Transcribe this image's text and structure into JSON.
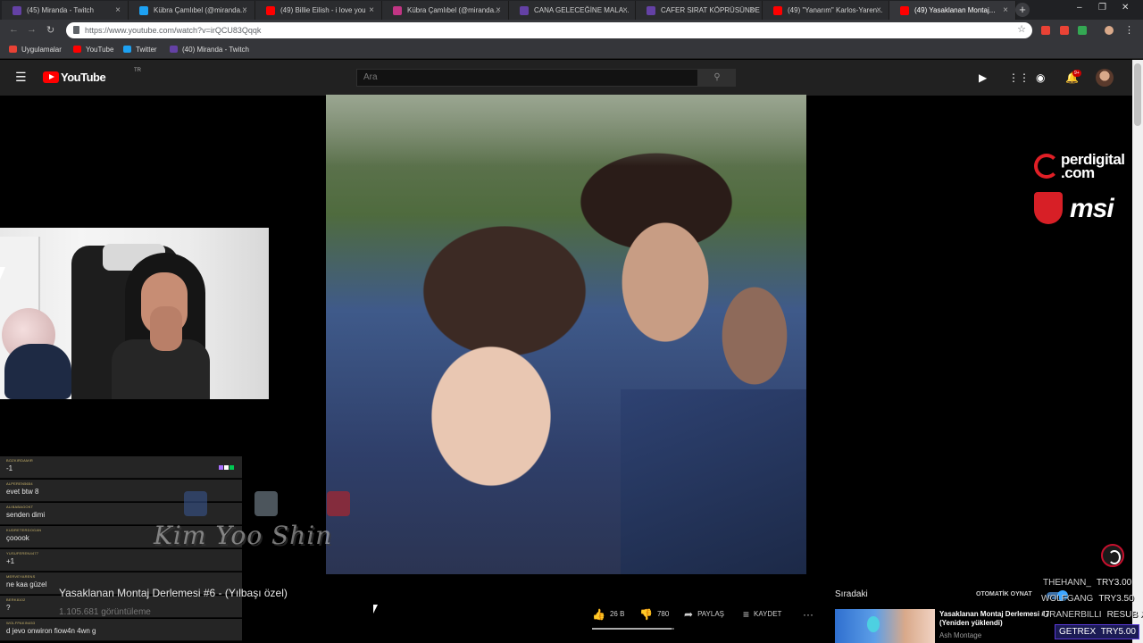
{
  "browser": {
    "tabs": [
      {
        "title": "(45) Miranda - Twitch",
        "color": "#6441a5"
      },
      {
        "title": "Kübra Çamlıbel (@miranda...",
        "color": "#1da1f2"
      },
      {
        "title": "(49) Billie Eilish - i love you",
        "color": "#ff0000"
      },
      {
        "title": "Kübra Çamlıbel (@miranda...",
        "color": "#c13584"
      },
      {
        "title": "CANA GELECEĞİNE MALA...",
        "color": "#6441a5"
      },
      {
        "title": "CAFER SIRAT KÖPRÜSÜNDE",
        "color": "#6441a5"
      },
      {
        "title": "(49) \"Yanarım\" Karlos-Yaren...",
        "color": "#ff0000"
      },
      {
        "title": "(49) Yasaklanan Montaj...",
        "color": "#ff0000"
      }
    ],
    "url": "https://www.youtube.com/watch?v=irQCU83Qqqk",
    "bookmarks": [
      {
        "label": "Uygulamalar",
        "color": "#e94235"
      },
      {
        "label": "YouTube",
        "color": "#ff0000"
      },
      {
        "label": "Twitter",
        "color": "#1da1f2"
      },
      {
        "label": "(40) Miranda - Twitch",
        "color": "#6441a5"
      }
    ]
  },
  "youtube": {
    "logo_text": "YouTube",
    "country": "TR",
    "search_placeholder": "Ara",
    "notification_count": "9+",
    "video": {
      "title": "Yasaklanan Montaj Derlemesi #6 - (Yılbaşı özel)",
      "views": "1.105.681 görüntüleme",
      "likes": "26 B",
      "dislikes": "780",
      "like_ratio": 0.97,
      "share_label": "PAYLAŞ",
      "save_label": "KAYDET"
    },
    "upnext": {
      "label": "Sıradaki",
      "autoplay_label": "OTOMATİK OYNAT",
      "title": "Yasaklanan Montaj Derlemesi #7 (Yeniden yüklendi)",
      "channel": "Ash Montage"
    }
  },
  "stream_overlay": {
    "sponsors": {
      "perdigital": "perdigital .com",
      "msi": "msi"
    },
    "watermark": "Kim Yoo Shin",
    "chat": [
      {
        "user": "BOZKIRDAMIR",
        "message": "-1"
      },
      {
        "user": "ALPEREN5654",
        "message": "evet btw 8"
      },
      {
        "user": "ALIBABAGOKT",
        "message": "senden dimi"
      },
      {
        "user": "KUDRETERDOGAN",
        "message": "çooook"
      },
      {
        "user": "YUSUFEREN4477",
        "message": "+1"
      },
      {
        "user": "MERVEYARENS",
        "message": "ne kaa güzel"
      },
      {
        "user": "BERK8102",
        "message": "?"
      },
      {
        "user": "WOLFPAKIN453",
        "message": "d jevo onwiron fiow4n 4wn g"
      }
    ],
    "donations": [
      {
        "name": "THEHANN_",
        "amount": "TRY3.00"
      },
      {
        "name": "WOLFGANG",
        "amount": "TRY3.50"
      },
      {
        "name": "URANERBILLI",
        "amount": "RESUB X"
      }
    ],
    "highlight_donation": {
      "name": "GETREX",
      "amount": "TRY5.00"
    }
  }
}
